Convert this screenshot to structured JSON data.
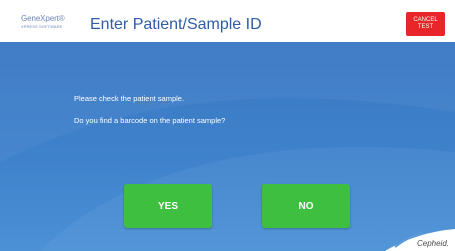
{
  "header": {
    "logo_name": "GeneXpert®",
    "logo_sub": "XPRESS SOFTWARE",
    "title": "Enter Patient/Sample ID",
    "cancel_line1": "CANCEL",
    "cancel_line2": "TEST"
  },
  "main": {
    "prompt_1": "Please check the patient sample.",
    "prompt_2": "Do you find a barcode on the patient sample?",
    "yes_label": "YES",
    "no_label": "NO"
  },
  "footer": {
    "brand": "Cepheid."
  },
  "colors": {
    "panel_blue": "#3f82cc",
    "button_green": "#3fbf3f",
    "cancel_red": "#e8262a",
    "title_blue": "#2e5ca8"
  }
}
